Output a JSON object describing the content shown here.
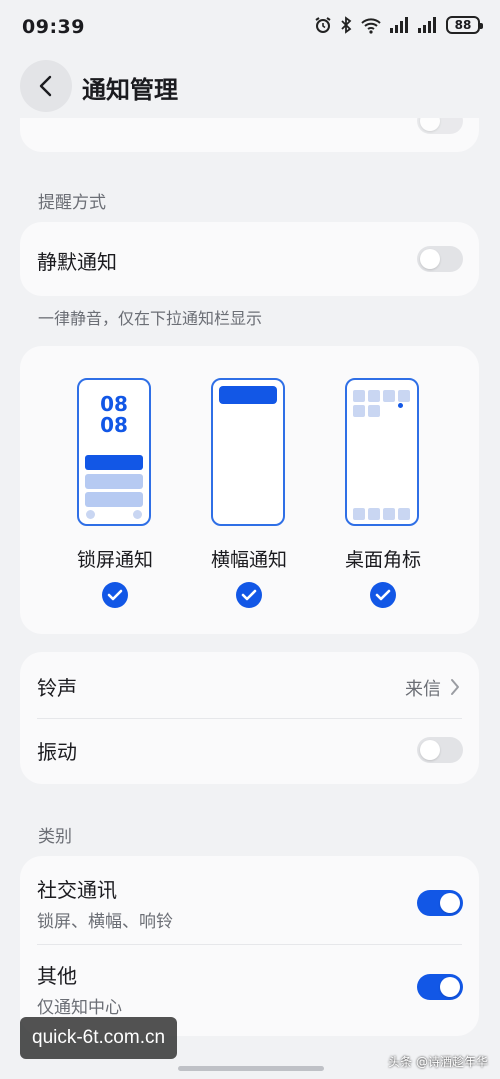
{
  "status_bar": {
    "time": "09:39",
    "battery": "88"
  },
  "header": {
    "title": "通知管理"
  },
  "reminder_section": {
    "label": "提醒方式",
    "silent_label": "静默通知",
    "silent_on": false,
    "hint": "一律静音，仅在下拉通知栏显示"
  },
  "styles": {
    "lock_screen": {
      "label": "锁屏通知",
      "clock_top": "08",
      "clock_bottom": "08",
      "checked": true
    },
    "banner": {
      "label": "横幅通知",
      "checked": true
    },
    "badge": {
      "label": "桌面角标",
      "checked": true
    }
  },
  "sound": {
    "ringtone_label": "铃声",
    "ringtone_value": "来信",
    "vibrate_label": "振动",
    "vibrate_on": false
  },
  "category_section": {
    "label": "类别",
    "items": [
      {
        "title": "社交通讯",
        "subtitle": "锁屏、横幅、响铃",
        "on": true
      },
      {
        "title": "其他",
        "subtitle": "仅通知中心",
        "on": true
      }
    ]
  },
  "watermark": {
    "text": "quick-6t.com.cn",
    "credit": "头条 @诗酒趁年华"
  },
  "colors": {
    "accent": "#1257e6",
    "background": "#f1f2f4",
    "card": "#fafafb"
  }
}
